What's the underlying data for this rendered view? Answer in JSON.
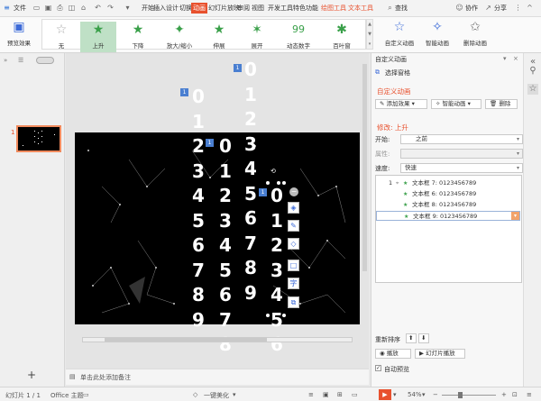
{
  "menubar": {
    "file": "文件",
    "items": [
      "开始",
      "插入",
      "设计",
      "切换",
      "动画",
      "幻灯片放映",
      "审阅",
      "视图",
      "开发工具",
      "特色功能",
      "绘图工具",
      "文本工具"
    ],
    "active_index": 4,
    "search": "查找",
    "collab": "协作",
    "share": "分享"
  },
  "ribbon": {
    "preview": "预览效果",
    "gallery": [
      {
        "label": "无",
        "icon": "star-empty-icon"
      },
      {
        "label": "上升",
        "icon": "star-up-icon",
        "selected": true
      },
      {
        "label": "下降",
        "icon": "star-down-icon"
      },
      {
        "label": "放大/缩小",
        "icon": "star-zoom-icon"
      },
      {
        "label": "伸展",
        "icon": "star-stretch-icon"
      },
      {
        "label": "展开",
        "icon": "star-expand-icon"
      },
      {
        "label": "动态数字",
        "icon": "dynamic-number-icon"
      },
      {
        "label": "百叶窗",
        "icon": "blinds-icon"
      }
    ],
    "custom_anim": "自定义动画",
    "smart_anim": "智能动画",
    "delete_anim": "删除动画"
  },
  "leftpane": {
    "tab_outline": "»",
    "slide_number": "1",
    "add_slide": "+"
  },
  "slide": {
    "columns": [
      {
        "digits": [
          "0",
          "1",
          "2",
          "3",
          "4",
          "5",
          "6",
          "7",
          "8",
          "9"
        ]
      },
      {
        "digits": [
          "0",
          "1",
          "2",
          "3",
          "4",
          "5",
          "6",
          "7",
          "8"
        ]
      },
      {
        "digits": [
          "0",
          "1",
          "2",
          "3",
          "4",
          "5",
          "6",
          "7",
          "8",
          "9"
        ]
      },
      {
        "digits": [
          "0",
          "1",
          "2",
          "3",
          "4",
          "5",
          "6"
        ]
      }
    ],
    "badges": [
      "1",
      "1",
      "1",
      "1"
    ]
  },
  "notes": {
    "placeholder": "单击此处添加备注"
  },
  "rpanel": {
    "title": "自定义动画",
    "select_pane": "选择窗格",
    "section_custom": "自定义动画",
    "add_effect": "添加效果",
    "smart_anim": "智能动画",
    "delete": "删除",
    "modify_label": "修改: 上升",
    "start_label": "开始:",
    "start_value": "之前",
    "property_label": "属性:",
    "property_value": "",
    "speed_label": "速度:",
    "speed_value": "快速",
    "items": [
      {
        "num": "1",
        "text": "文本框 7: 0123456789"
      },
      {
        "num": "",
        "text": "文本框 6: 0123456789"
      },
      {
        "num": "",
        "text": "文本框 8: 0123456789"
      },
      {
        "num": "",
        "text": "文本框 9: 0123456789"
      }
    ],
    "reorder": "重新排序",
    "play": "播放",
    "slideshow": "幻灯片播放",
    "autopreview": "自动预览"
  },
  "statusbar": {
    "slide_info": "幻灯片 1 / 1",
    "theme": "Office 主题",
    "beautify": "一键美化",
    "zoom": "54%",
    "zoom_fraction": 0.3
  },
  "colors": {
    "accent": "#e8512e",
    "select_blue": "#4a7fd1",
    "slide_bg": "#000000"
  }
}
